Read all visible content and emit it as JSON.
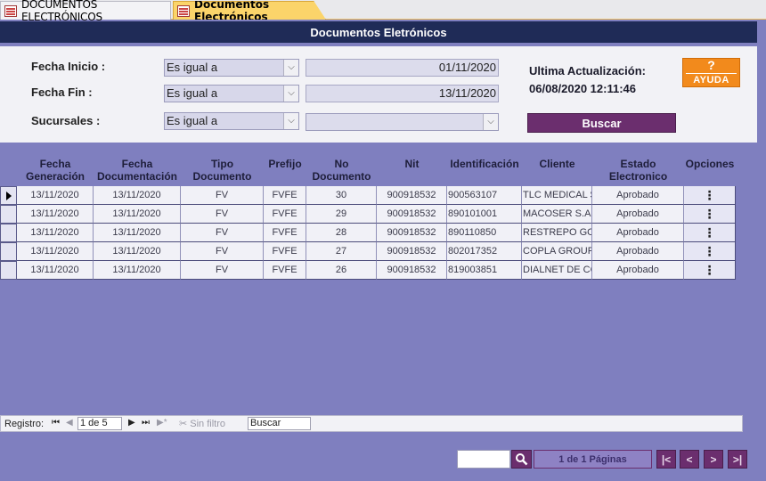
{
  "tabs": [
    {
      "label": "DOCUMENTOS ELECTRÓNICOS"
    },
    {
      "label": "Documentos Electrónicos"
    }
  ],
  "title": "Documentos Eletrónicos",
  "filters": {
    "fecha_inicio": {
      "label": "Fecha Inicio :",
      "operator": "Es igual a",
      "value": "01/11/2020"
    },
    "fecha_fin": {
      "label": "Fecha Fin :",
      "operator": "Es igual a",
      "value": "13/11/2020"
    },
    "sucursales": {
      "label": "Sucursales :",
      "operator": "Es igual a",
      "value": ""
    }
  },
  "last_update": {
    "label": "Ultima Actualización:",
    "value": "06/08/2020 12:11:46"
  },
  "help": {
    "symbol": "?",
    "label": "AYUDA",
    "color": "#f28a1c"
  },
  "search_button": "Buscar",
  "grid": {
    "headers": {
      "fecha_gen": "Fecha Generación",
      "fecha_doc": "Fecha Documentación",
      "tipo": "Tipo Documento",
      "prefijo": "Prefijo",
      "numero": "No Documento",
      "nit": "Nit",
      "ident": "Identificación",
      "cliente": "Cliente",
      "estado": "Estado Electronico",
      "opciones": "Opciones"
    },
    "rows": [
      {
        "fecha_gen": "13/11/2020",
        "fecha_doc": "13/11/2020",
        "tipo": "FV",
        "prefijo": "FVFE",
        "numero": "30",
        "nit": "900918532",
        "ident": "900563107",
        "cliente": "TLC MEDICAL S",
        "estado": "Aprobado",
        "opcion": "⋮"
      },
      {
        "fecha_gen": "13/11/2020",
        "fecha_doc": "13/11/2020",
        "tipo": "FV",
        "prefijo": "FVFE",
        "numero": "29",
        "nit": "900918532",
        "ident": "890101001",
        "cliente": "MACOSER S.A.",
        "estado": "Aprobado",
        "opcion": "⋮"
      },
      {
        "fecha_gen": "13/11/2020",
        "fecha_doc": "13/11/2020",
        "tipo": "FV",
        "prefijo": "FVFE",
        "numero": "28",
        "nit": "900918532",
        "ident": "890110850",
        "cliente": "RESTREPO GOM",
        "estado": "Aprobado",
        "opcion": "⋮"
      },
      {
        "fecha_gen": "13/11/2020",
        "fecha_doc": "13/11/2020",
        "tipo": "FV",
        "prefijo": "FVFE",
        "numero": "27",
        "nit": "900918532",
        "ident": "802017352",
        "cliente": "COPLA GROUP",
        "estado": "Aprobado",
        "opcion": "⋮"
      },
      {
        "fecha_gen": "13/11/2020",
        "fecha_doc": "13/11/2020",
        "tipo": "FV",
        "prefijo": "FVFE",
        "numero": "26",
        "nit": "900918532",
        "ident": "819003851",
        "cliente": "DIALNET DE CC",
        "estado": "Aprobado",
        "opcion": "⋮"
      }
    ]
  },
  "record_nav": {
    "label": "Registro:",
    "first": "⏮",
    "prev": "◀",
    "current": "1 de 5",
    "next": "▶",
    "last": "⏭",
    "new": "▶*",
    "no_filter": "Sin filtro",
    "search": "Buscar"
  },
  "pager": {
    "info": "1 de 1 Páginas",
    "first": "|<",
    "prev": "<",
    "next": ">",
    "last": ">|"
  }
}
